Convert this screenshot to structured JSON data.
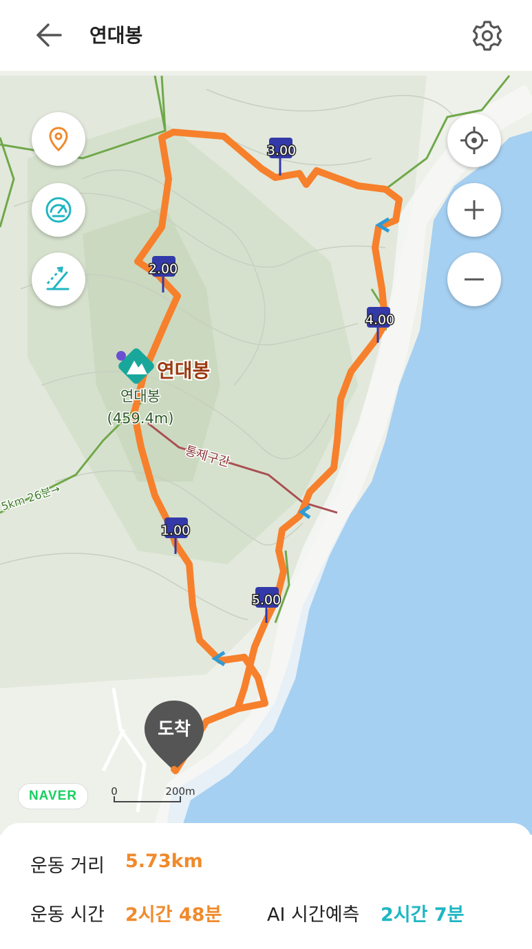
{
  "header": {
    "title": "연대봉"
  },
  "map": {
    "peak_label": "연대봉",
    "peak_name_line1": "연대봉",
    "peak_name_line2": "(459.4m)",
    "restricted_label": "통제구간",
    "trail_hint": "5km 26분→",
    "km_markers": [
      "1.00",
      "2.00",
      "3.00",
      "4.00",
      "5.00"
    ],
    "arrival_label": "도착",
    "scale_zero": "0",
    "scale_distance": "200m",
    "provider_logo": "NAVER",
    "route_color": "#f7802c",
    "sea_color": "#a6d0f2",
    "buttons": [
      "location-pin-icon",
      "speedometer-icon",
      "slope-icon",
      "gps-target-icon",
      "zoom-in-icon",
      "zoom-out-icon"
    ]
  },
  "stats": {
    "distance_label": "운동 거리",
    "distance_value": "5.73km",
    "time_label": "운동 시간",
    "time_value": "2시간 48분",
    "ai_label": "AI 시간예측",
    "ai_value": "2시간 7분"
  }
}
